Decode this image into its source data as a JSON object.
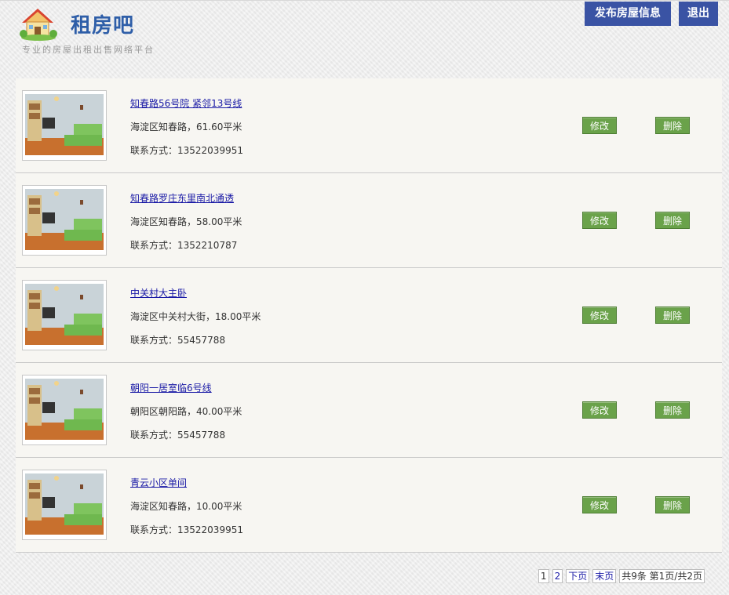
{
  "header": {
    "brand_title": "租房吧",
    "brand_subtitle": "专业的房屋出租出售网络平台",
    "publish_button": "发布房屋信息",
    "logout_button": "退出"
  },
  "listings": [
    {
      "title": "知春路56号院 紧邻13号线",
      "address": "海淀区知春路，61.60平米",
      "contact": "联系方式：13522039951",
      "edit_label": "修改",
      "delete_label": "删除"
    },
    {
      "title": "知春路罗庄东里南北通透",
      "address": "海淀区知春路，58.00平米",
      "contact": "联系方式：1352210787",
      "edit_label": "修改",
      "delete_label": "删除"
    },
    {
      "title": "中关村大主卧",
      "address": "海淀区中关村大街，18.00平米",
      "contact": "联系方式：55457788",
      "edit_label": "修改",
      "delete_label": "删除"
    },
    {
      "title": "朝阳一居室临6号线",
      "address": "朝阳区朝阳路，40.00平米",
      "contact": "联系方式：55457788",
      "edit_label": "修改",
      "delete_label": "删除"
    },
    {
      "title": "青云小区单间",
      "address": "海淀区知春路，10.00平米",
      "contact": "联系方式：13522039951",
      "edit_label": "修改",
      "delete_label": "删除"
    }
  ],
  "pagination": {
    "page1": "1",
    "page2": "2",
    "next": "下页",
    "last": "末页",
    "summary": "共9条 第1页/共2页"
  },
  "icons": {
    "logo": "house-logo-icon"
  }
}
